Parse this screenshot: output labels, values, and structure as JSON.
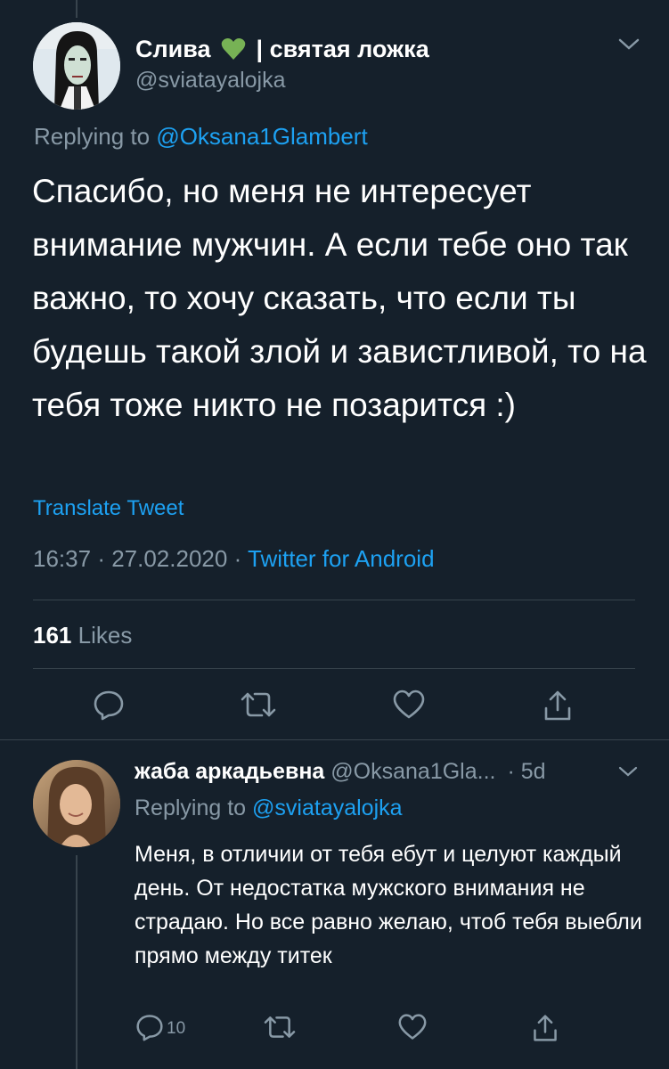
{
  "tweet": {
    "display_name": "Слива",
    "name_suffix": "| святая ложка",
    "handle": "@sviatayalojka",
    "replying_prefix": "Replying to",
    "replying_to": "@Oksana1Glambert",
    "body": "Спасибо, но меня не интересует внимание мужчин. А если тебе оно так важно, то хочу сказать, что если ты будешь такой злой и завистливой, то на тебя тоже никто не позарится :)",
    "translate_label": "Translate Tweet",
    "time": "16:37",
    "date": "27.02.2020",
    "source": "Twitter for Android",
    "likes_count": "161",
    "likes_label": "Likes"
  },
  "reply": {
    "display_name": "жаба аркадьевна",
    "handle": "@Oksana1Gla...",
    "age": "· 5d",
    "replying_prefix": "Replying to",
    "replying_to": "@sviatayalojka",
    "body": "Меня, в отличии от тебя ебут и целуют каждый день. От недостатка мужского внимания не страдаю. Но все равно желаю, чтоб тебя выебли прямо между титек",
    "reply_count": "10"
  },
  "colors": {
    "background": "#15202b",
    "text": "#ffffff",
    "muted": "#8899a6",
    "accent": "#1da1f2",
    "divider": "#38444d",
    "heart_emoji": "#77b255"
  },
  "icons": [
    "green-heart-icon",
    "chevron-down-icon",
    "reply-icon",
    "retweet-icon",
    "like-icon",
    "share-icon"
  ]
}
